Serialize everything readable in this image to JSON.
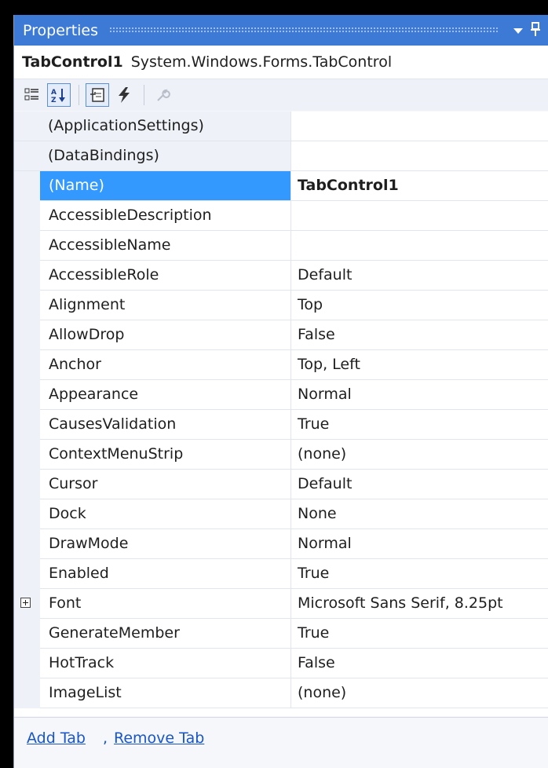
{
  "window": {
    "title": "Properties",
    "dropdown_icon": "triangle-down-icon",
    "pin_icon": "pin-icon"
  },
  "object_selector": {
    "name": "TabControl1",
    "type": "System.Windows.Forms.TabControl"
  },
  "toolbar": {
    "buttons": [
      {
        "icon": "categorized-icon",
        "selected": false
      },
      {
        "icon": "alphabetical-icon",
        "selected": true
      },
      {
        "icon": "properties-icon",
        "selected": true
      },
      {
        "icon": "events-icon",
        "selected": false
      },
      {
        "icon": "property-pages-icon",
        "selected": false
      }
    ]
  },
  "properties": [
    {
      "name": "(ApplicationSettings)",
      "value": "",
      "expandable": true,
      "category": true
    },
    {
      "name": "(DataBindings)",
      "value": "",
      "expandable": true,
      "category": true
    },
    {
      "name": "(Name)",
      "value": "TabControl1",
      "selected": true,
      "bold": true
    },
    {
      "name": "AccessibleDescription",
      "value": ""
    },
    {
      "name": "AccessibleName",
      "value": ""
    },
    {
      "name": "AccessibleRole",
      "value": "Default"
    },
    {
      "name": "Alignment",
      "value": "Top"
    },
    {
      "name": "AllowDrop",
      "value": "False"
    },
    {
      "name": "Anchor",
      "value": "Top, Left"
    },
    {
      "name": "Appearance",
      "value": "Normal"
    },
    {
      "name": "CausesValidation",
      "value": "True"
    },
    {
      "name": "ContextMenuStrip",
      "value": "(none)"
    },
    {
      "name": "Cursor",
      "value": "Default"
    },
    {
      "name": "Dock",
      "value": "None"
    },
    {
      "name": "DrawMode",
      "value": "Normal"
    },
    {
      "name": "Enabled",
      "value": "True"
    },
    {
      "name": "Font",
      "value": "Microsoft Sans Serif, 8.25pt",
      "expandable": true
    },
    {
      "name": "GenerateMember",
      "value": "True"
    },
    {
      "name": "HotTrack",
      "value": "False"
    },
    {
      "name": "ImageList",
      "value": "(none)"
    }
  ],
  "commands": {
    "add_tab": "Add Tab",
    "separator": ",",
    "remove_tab": "Remove Tab"
  },
  "colors": {
    "title_bar": "#3d7ad6",
    "selection": "#3399ff",
    "link": "#1a55c8"
  }
}
